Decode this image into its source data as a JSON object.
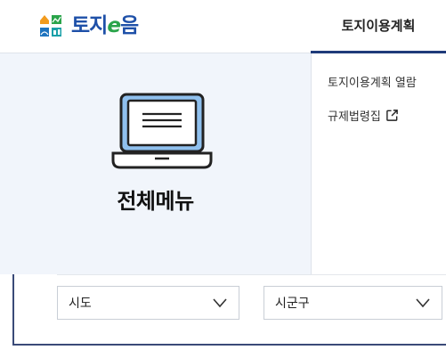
{
  "header": {
    "logo_text": "토지",
    "logo_e": "e",
    "logo_text2": "음",
    "nav_tab": "토지이용계획"
  },
  "menu": {
    "title": "전체메뉴"
  },
  "dropdown": {
    "items": [
      {
        "label": "토지이용계획 열람"
      },
      {
        "label": "규제법령집"
      }
    ]
  },
  "search": {
    "sido_label": "시도",
    "sigungu_label": "시군구"
  },
  "colors": {
    "brand_blue": "#1e50a8",
    "brand_green": "#2aa44a",
    "nav_underline": "#1f3b7a",
    "menu_bg": "#f1f5fb"
  }
}
